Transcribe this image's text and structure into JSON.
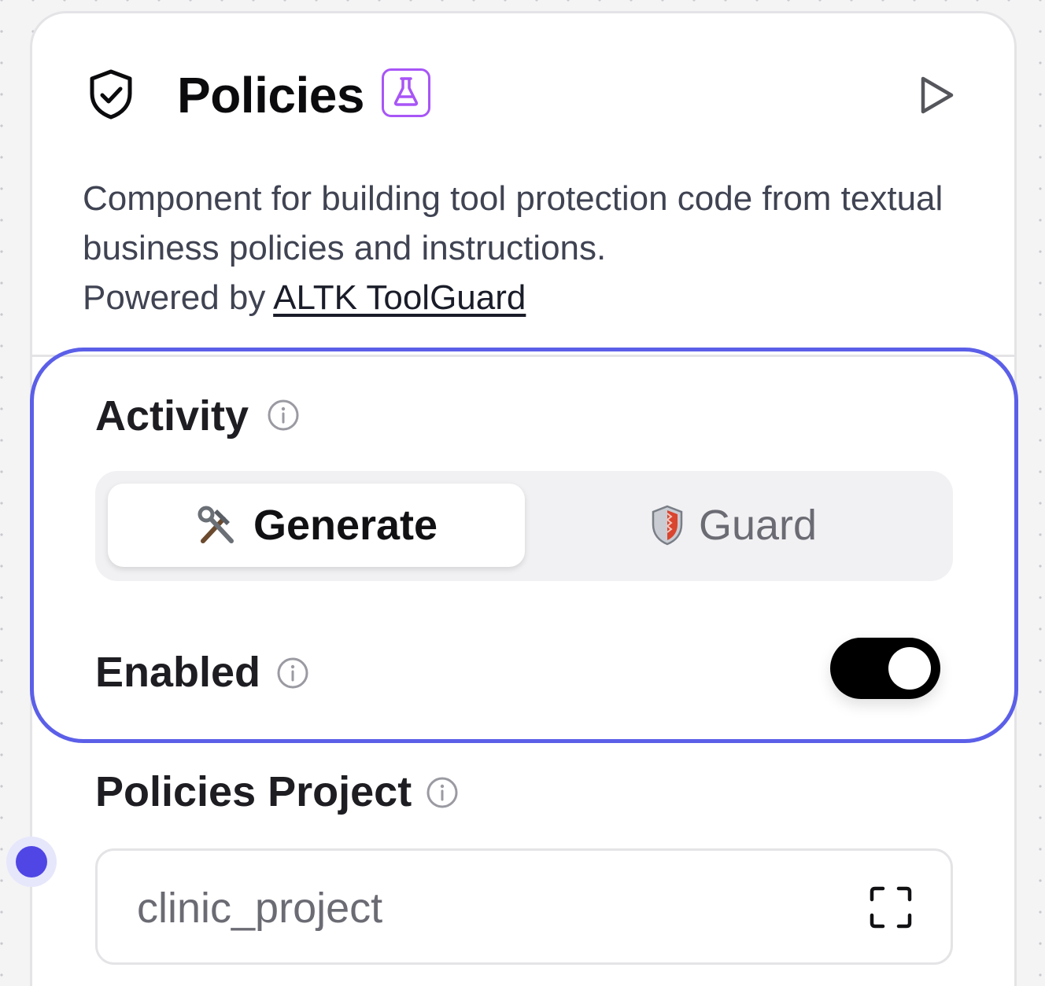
{
  "node": {
    "title": "Policies",
    "icon": "shield-check-icon",
    "badge_icon": "flask-icon",
    "run_icon": "play-icon",
    "description_text": "Component for building tool protection code from textual business policies and instructions.",
    "powered_by_prefix": "Powered by ",
    "powered_by_link": "ALTK ToolGuard"
  },
  "activity": {
    "label": "Activity",
    "options": [
      {
        "emoji": "hammer-and-wrench",
        "label": "Generate",
        "selected": true
      },
      {
        "emoji": "shield",
        "label": "Guard",
        "selected": false
      }
    ]
  },
  "enabled": {
    "label": "Enabled",
    "value": true
  },
  "policies_project": {
    "label": "Policies Project",
    "value": "clinic_project",
    "expand_icon": "expand-icon"
  },
  "colors": {
    "accent": "#5b5fe8",
    "badge": "#a855f7",
    "handle": "#4f46e5"
  }
}
